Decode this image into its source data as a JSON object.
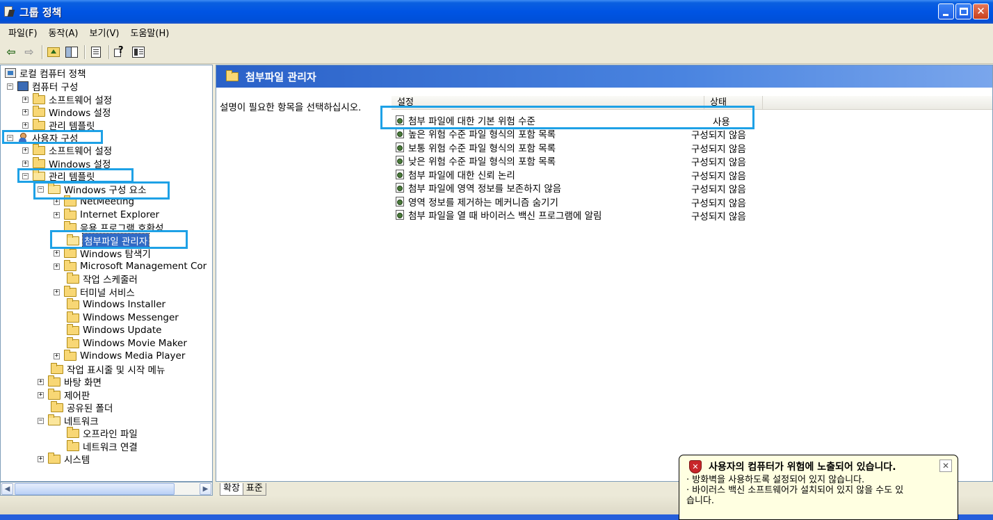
{
  "window": {
    "title": "그룹 정책"
  },
  "menu": [
    {
      "label": "파일",
      "hotkey": "(F)"
    },
    {
      "label": "동작",
      "hotkey": "(A)"
    },
    {
      "label": "보기",
      "hotkey": "(V)"
    },
    {
      "label": "도움말",
      "hotkey": "(H)"
    }
  ],
  "tree": {
    "root": "로컬 컴퓨터 정책",
    "computer": "컴퓨터 구성",
    "c_software": "소프트웨어 설정",
    "c_windows": "Windows 설정",
    "c_admin": "관리 템플릿",
    "user": "사용자 구성",
    "u_software": "소프트웨어 설정",
    "u_windows": "Windows 설정",
    "u_admin": "관리 템플릿",
    "win_components": "Windows 구성 요소",
    "netmeeting": "NetMeeting",
    "ie": "Internet Explorer",
    "app_compat": "응용 프로그램 호환성",
    "attachment_manager": "첨부파일 관리자",
    "explorer": "Windows 탐색기",
    "mmc": "Microsoft Management Cor",
    "task_scheduler": "작업 스케줄러",
    "terminal_services": "터미널 서비스",
    "installer": "Windows Installer",
    "messenger": "Windows Messenger",
    "update": "Windows Update",
    "movie_maker": "Windows Movie Maker",
    "media_player": "Windows Media Player",
    "taskbar_start": "작업 표시줄 및 시작 메뉴",
    "desktop": "바탕 화면",
    "control_panel": "제어판",
    "shared_folders": "공유된 폴더",
    "network": "네트워크",
    "offline_files": "오프라인 파일",
    "network_connections": "네트워크 연결",
    "system": "시스템"
  },
  "right": {
    "header": "첨부파일 관리자",
    "description": "설명이 필요한 항목을 선택하십시오.",
    "col_setting": "설정",
    "col_state": "상태",
    "rows": [
      {
        "setting": "첨부 파일에 대한 기본 위험 수준",
        "state": "사용"
      },
      {
        "setting": "높은 위험 수준 파일 형식의 포함 목록",
        "state": "구성되지 않음"
      },
      {
        "setting": "보통 위험 수준 파일 형식의 포함 목록",
        "state": "구성되지 않음"
      },
      {
        "setting": "낮은 위험 수준 파일 형식의 포함 목록",
        "state": "구성되지 않음"
      },
      {
        "setting": "첨부 파일에 대한 신뢰 논리",
        "state": "구성되지 않음"
      },
      {
        "setting": "첨부 파일에 영역 정보를 보존하지 않음",
        "state": "구성되지 않음"
      },
      {
        "setting": "영역 정보를 제거하는 메커니즘 숨기기",
        "state": "구성되지 않음"
      },
      {
        "setting": "첨부 파일을 열 때 바이러스 백신 프로그램에 알림",
        "state": "구성되지 않음"
      }
    ]
  },
  "tabs": [
    "확장",
    "표준"
  ],
  "balloon": {
    "title": "사용자의 컴퓨터가 위험에 노출되어 있습니다.",
    "line1": "· 방화벽을 사용하도록 설정되어 있지 않습니다.",
    "line2": "· 바이러스 백신 소프트웨어가 설치되어 있지 않을 수도 있",
    "line3": "습니다."
  },
  "colors": {
    "accent": "#316ac5",
    "highlight_box": "#1ea1e6",
    "titlebar": "#0054e3"
  }
}
